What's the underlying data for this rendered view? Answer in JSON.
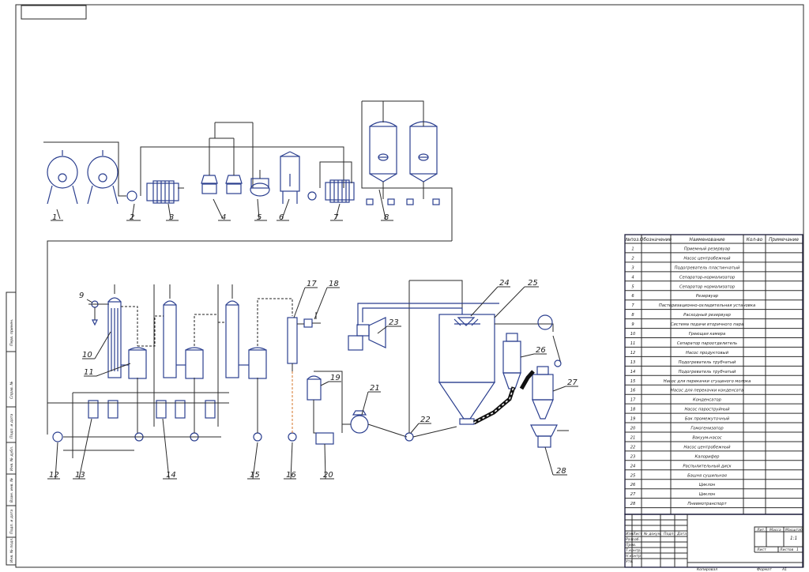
{
  "table": {
    "headers": [
      "№поз.",
      "Обозначение",
      "Наименование",
      "Кол-во",
      "Примечание"
    ],
    "rows": [
      {
        "n": "1",
        "name": "Приемный резервуар"
      },
      {
        "n": "2",
        "name": "Насос центробежный"
      },
      {
        "n": "3",
        "name": "Подогреватель пластинчатый"
      },
      {
        "n": "4",
        "name": "Сепаратор-нормализатор"
      },
      {
        "n": "5",
        "name": "Сепаратор нормализатор"
      },
      {
        "n": "6",
        "name": "Резервуар"
      },
      {
        "n": "7",
        "name": "Пастеризационно-охладительная установка"
      },
      {
        "n": "8",
        "name": "Расходный резервуар"
      },
      {
        "n": "9",
        "name": "Система подачи вторичного пара"
      },
      {
        "n": "10",
        "name": "Греющая камера"
      },
      {
        "n": "11",
        "name": "Сепаратор пароотделитель"
      },
      {
        "n": "12",
        "name": "Насос продуктовый"
      },
      {
        "n": "13",
        "name": "Подогреватель трубчатый"
      },
      {
        "n": "14",
        "name": "Подогреватель трубчатый"
      },
      {
        "n": "15",
        "name": "Насос для перекачки сгущеного молока"
      },
      {
        "n": "16",
        "name": "Насос для перекачки конденсата"
      },
      {
        "n": "17",
        "name": "Конденсатор"
      },
      {
        "n": "18",
        "name": "Насос пароструйный"
      },
      {
        "n": "19",
        "name": "Бак промежуточный"
      },
      {
        "n": "20",
        "name": "Гомогенизатор"
      },
      {
        "n": "21",
        "name": "Вакуум-насос"
      },
      {
        "n": "22",
        "name": "Насос центробежный"
      },
      {
        "n": "23",
        "name": "Калорифер"
      },
      {
        "n": "24",
        "name": "Распылительный диск"
      },
      {
        "n": "25",
        "name": "Башня сушильная"
      },
      {
        "n": "26",
        "name": "Циклон"
      },
      {
        "n": "27",
        "name": "Циклон"
      },
      {
        "n": "28",
        "name": "Пневмотранспорт"
      }
    ]
  },
  "labels": [
    "1",
    "2",
    "3",
    "4",
    "5",
    "6",
    "7",
    "8",
    "9",
    "10",
    "11",
    "12",
    "13",
    "14",
    "15",
    "16",
    "17",
    "18",
    "19",
    "20",
    "21",
    "22",
    "23",
    "24",
    "25",
    "26",
    "27",
    "28"
  ],
  "title_block": {
    "col_headers": [
      "Изм.",
      "Лист",
      "№ докум.",
      "Подп.",
      "Дата"
    ],
    "row_labels": [
      "Разраб.",
      "Пров.",
      "Т.контр.",
      "Н.контр.",
      "Утв."
    ],
    "lit_label": "Лит.",
    "mass_label": "Масса",
    "scale_label": "Масштаб",
    "scale_value": "1:1",
    "sheet_label": "Лист",
    "sheets_label": "Листов",
    "sheets_value": "1",
    "copied": "Копировал",
    "format": "Формат",
    "format_value": "А1"
  },
  "side_stamp": [
    "Перв. примен.",
    "Справ. №",
    "Подп. и дата",
    "Инв. № дубл.",
    "Взам. инв. №",
    "Подп. и дата",
    "Инв. № подл."
  ],
  "accent_colors": {
    "equipment": "#2b3f8f",
    "lines": "#2a2a2a",
    "highlight": "#d4752a"
  }
}
